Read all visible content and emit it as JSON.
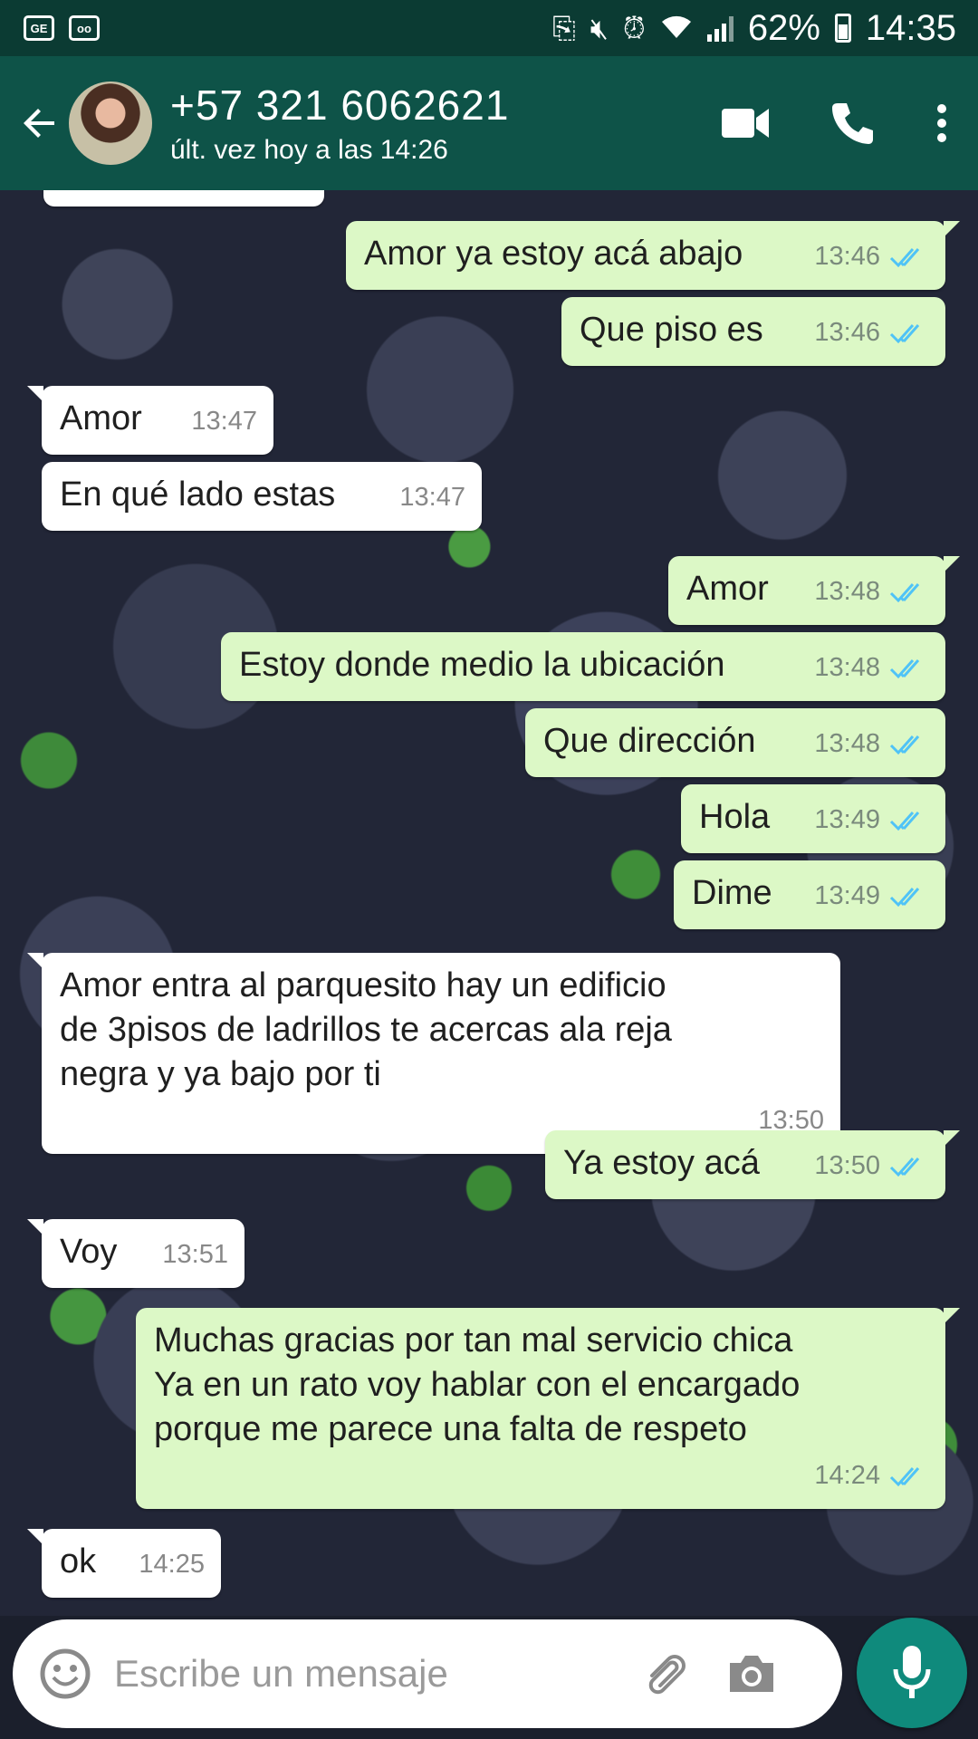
{
  "status_bar": {
    "left_icons": [
      "ge-icon",
      "voicemail-icon"
    ],
    "left_labels": [
      "GE",
      "oo"
    ],
    "right_icons": [
      "nfc-icon",
      "mute-icon",
      "alarm-icon",
      "wifi-icon",
      "signal-icon",
      "battery-icon"
    ],
    "battery": "62%",
    "time": "14:35"
  },
  "header": {
    "contact_name": "+57 321 6062621",
    "last_seen": "últ. vez hoy a las 14:26",
    "icons": [
      "back-arrow-icon",
      "avatar",
      "video-call-icon",
      "phone-icon",
      "more-vert-icon"
    ]
  },
  "colors": {
    "header_bg": "#0e5348",
    "status_bar_bg": "#0b3b33",
    "outgoing_bubble": "#dcf8c6",
    "incoming_bubble": "#ffffff",
    "read_ticks": "#4fc3f7",
    "mic_button": "#0f8a7c"
  },
  "messages": [
    {
      "dir": "out",
      "text": "Amor ya estoy acá abajo",
      "time": "13:46",
      "status": "read"
    },
    {
      "dir": "out",
      "text": "Que piso es",
      "time": "13:46",
      "status": "read"
    },
    {
      "dir": "in",
      "text": "Amor",
      "time": "13:47"
    },
    {
      "dir": "in",
      "text": "En qué lado estas",
      "time": "13:47"
    },
    {
      "dir": "out",
      "text": "Amor",
      "time": "13:48",
      "status": "read"
    },
    {
      "dir": "out",
      "text": "Estoy donde medio la ubicación",
      "time": "13:48",
      "status": "read"
    },
    {
      "dir": "out",
      "text": "Que dirección",
      "time": "13:48",
      "status": "read"
    },
    {
      "dir": "out",
      "text": "Hola",
      "time": "13:49",
      "status": "read"
    },
    {
      "dir": "out",
      "text": "Dime",
      "time": "13:49",
      "status": "read"
    },
    {
      "dir": "in",
      "lines": [
        "Amor entra al parquesito hay un edificio",
        "de 3pisos de ladrillos te acercas ala reja",
        "negra y ya bajo por ti"
      ],
      "time": "13:50"
    },
    {
      "dir": "out",
      "text": "Ya estoy acá",
      "time": "13:50",
      "status": "read"
    },
    {
      "dir": "in",
      "text": "Voy",
      "time": "13:51"
    },
    {
      "dir": "out",
      "lines": [
        "Muchas gracias por tan mal servicio chica",
        "Ya en un rato voy hablar con el encargado",
        "porque me parece una falta de respeto"
      ],
      "time": "14:24",
      "status": "read"
    },
    {
      "dir": "in",
      "text": "ok",
      "time": "14:25"
    }
  ],
  "composer": {
    "placeholder": "Escribe un mensaje",
    "icons": [
      "emoji-icon",
      "attach-icon",
      "camera-icon",
      "mic-icon"
    ]
  }
}
